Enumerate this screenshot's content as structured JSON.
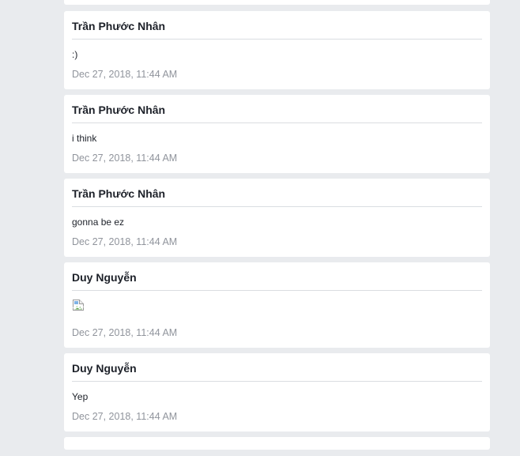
{
  "messages": [
    {
      "author": "Trần Phước Nhân",
      "text": ":)",
      "time": "Dec 27, 2018, 11:44 AM"
    },
    {
      "author": "Trần Phước Nhân",
      "text": "i think",
      "time": "Dec 27, 2018, 11:44 AM"
    },
    {
      "author": "Trần Phước Nhân",
      "text": "gonna be ez",
      "time": "Dec 27, 2018, 11:44 AM"
    },
    {
      "author": "Duy Nguyễn",
      "image": "broken-image-icon",
      "time": "Dec 27, 2018, 11:44 AM"
    },
    {
      "author": "Duy Nguyễn",
      "text": "Yep",
      "time": "Dec 27, 2018, 11:44 AM"
    }
  ]
}
